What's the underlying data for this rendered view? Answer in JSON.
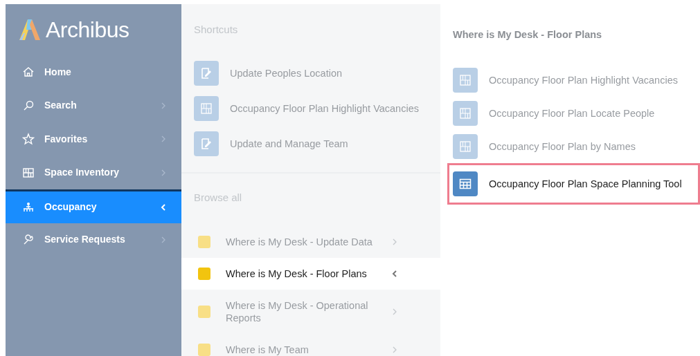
{
  "brand": "Archibus",
  "sidebar": {
    "items": [
      {
        "label": "Home",
        "kind": "home",
        "has_submenu": false,
        "selected": false
      },
      {
        "label": "Search",
        "kind": "search",
        "has_submenu": true,
        "selected": false
      },
      {
        "label": "Favorites",
        "kind": "star",
        "has_submenu": true,
        "selected": false
      },
      {
        "label": "Space Inventory",
        "kind": "plan",
        "has_submenu": true,
        "selected": false
      },
      {
        "label": "Occupancy",
        "kind": "people",
        "has_submenu": true,
        "selected": true
      },
      {
        "label": "Service Requests",
        "kind": "wrench",
        "has_submenu": true,
        "selected": false
      }
    ]
  },
  "shortcuts": {
    "title": "Shortcuts",
    "items": [
      {
        "label": "Update Peoples Location",
        "kind": "edit"
      },
      {
        "label": "Occupancy Floor Plan Highlight Vacancies",
        "kind": "plan"
      },
      {
        "label": "Update and Manage Team",
        "kind": "edit"
      }
    ]
  },
  "browse": {
    "title": "Browse all",
    "items": [
      {
        "label": "Where is My Desk - Update Data",
        "selected": false
      },
      {
        "label": "Where is My Desk - Floor Plans",
        "selected": true
      },
      {
        "label": "Where is My Desk - Operational Reports",
        "selected": false
      },
      {
        "label": "Where is My Team",
        "selected": false
      }
    ]
  },
  "detail": {
    "title": "Where is My Desk - Floor Plans",
    "items": [
      {
        "label": "Occupancy Floor Plan Highlight Vacancies",
        "selected": false
      },
      {
        "label": "Occupancy Floor Plan Locate People",
        "selected": false
      },
      {
        "label": "Occupancy Floor Plan by Names",
        "selected": false
      },
      {
        "label": "Occupancy Floor Plan Space Planning Tool",
        "selected": true
      }
    ]
  }
}
